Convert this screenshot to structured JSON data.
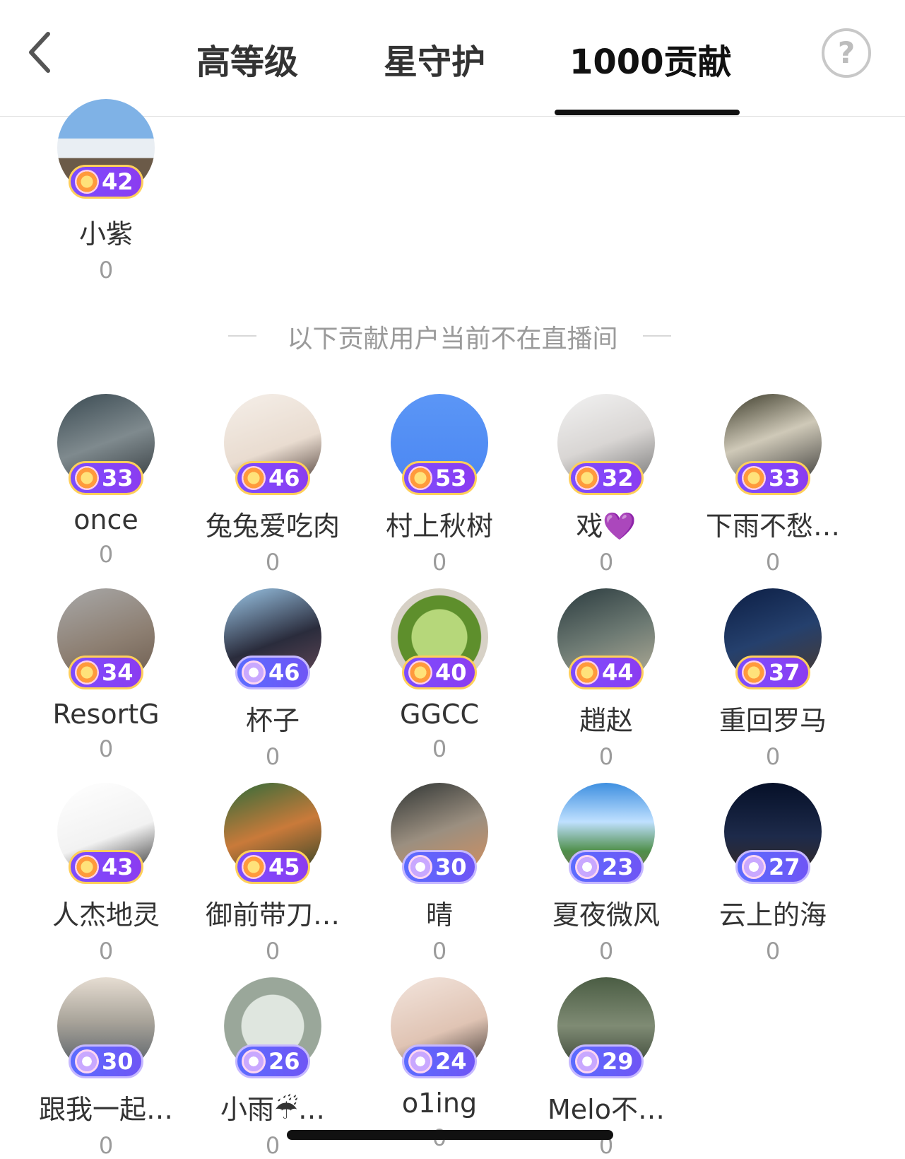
{
  "header": {
    "tabs": [
      {
        "label": "高等级"
      },
      {
        "label": "星守护"
      },
      {
        "label": "1000贡献"
      }
    ],
    "help_label": "?"
  },
  "top_user": {
    "name": "小紫",
    "level": "42",
    "value": "0"
  },
  "divider_text": "以下贡献用户当前不在直播间",
  "users": [
    {
      "name": "once",
      "level": "33",
      "value": "0"
    },
    {
      "name": "兔兔爱吃肉",
      "level": "46",
      "value": "0"
    },
    {
      "name": "村上秋树",
      "level": "53",
      "value": "0"
    },
    {
      "name": "戏💜",
      "level": "32",
      "value": "0"
    },
    {
      "name": "下雨不愁…",
      "level": "33",
      "value": "0"
    },
    {
      "name": "ResortG",
      "level": "34",
      "value": "0"
    },
    {
      "name": "杯子",
      "level": "46",
      "value": "0"
    },
    {
      "name": "GGCC",
      "level": "40",
      "value": "0"
    },
    {
      "name": "趙赵",
      "level": "44",
      "value": "0"
    },
    {
      "name": "重回罗马",
      "level": "37",
      "value": "0"
    },
    {
      "name": "人杰地灵",
      "level": "43",
      "value": "0"
    },
    {
      "name": "御前带刀…",
      "level": "45",
      "value": "0"
    },
    {
      "name": "晴",
      "level": "30",
      "value": "0"
    },
    {
      "name": "夏夜微风",
      "level": "23",
      "value": "0"
    },
    {
      "name": "云上的海",
      "level": "27",
      "value": "0"
    },
    {
      "name": "跟我一起…",
      "level": "30",
      "value": "0"
    },
    {
      "name": "小雨☔…",
      "level": "26",
      "value": "0"
    },
    {
      "name": "o1ing",
      "level": "24",
      "value": "0"
    },
    {
      "name": "Melo不…",
      "level": "29",
      "value": "0"
    }
  ]
}
